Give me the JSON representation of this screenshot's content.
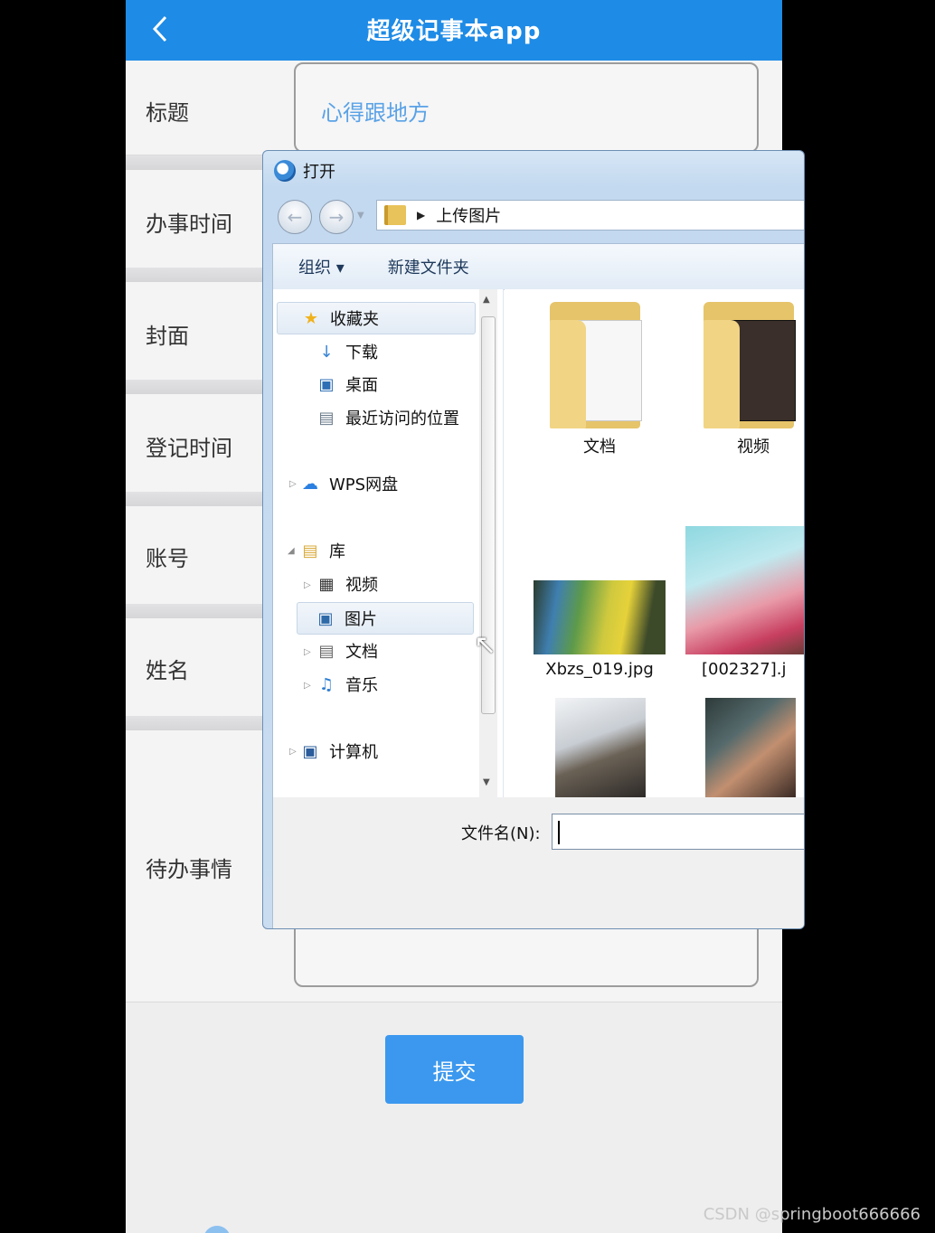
{
  "app": {
    "title": "超级记事本app"
  },
  "form": {
    "title_label": "标题",
    "title_value": "心得跟地方",
    "time_label": "办事时间",
    "cover_label": "封面",
    "register_label": "登记时间",
    "account_label": "账号",
    "name_label": "姓名",
    "todo_label": "待办事情",
    "submit_label": "提交"
  },
  "dialog": {
    "title": "打开",
    "breadcrumb": "上传图片",
    "toolbar": {
      "organize": "组织 ▾",
      "new_folder": "新建文件夹"
    },
    "nav": {
      "favorites": "收藏夹",
      "downloads": "下载",
      "desktop": "桌面",
      "recent": "最近访问的位置",
      "wps": "WPS网盘",
      "library": "库",
      "videos": "视频",
      "pictures": "图片",
      "documents": "文档",
      "music": "音乐",
      "computer": "计算机"
    },
    "files": [
      {
        "name": "文档",
        "type": "folder"
      },
      {
        "name": "视频",
        "type": "folder"
      },
      {
        "name": "Xbzs_019.jpg",
        "type": "image"
      },
      {
        "name": "[002327].j",
        "type": "image"
      }
    ],
    "filename_label": "文件名(N):",
    "filename_value": ""
  },
  "watermark": "CSDN @springboot666666"
}
